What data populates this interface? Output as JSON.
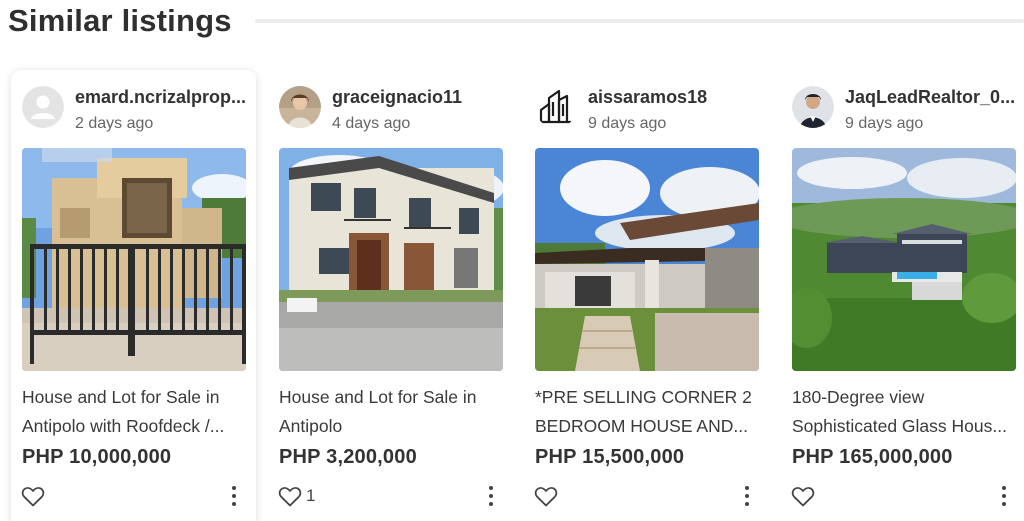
{
  "section": {
    "title": "Similar listings"
  },
  "listings": [
    {
      "user": "emard.ncrizalprop...",
      "time": "2 days ago",
      "title_lines": [
        "House and Lot for Sale in",
        "Antipolo with Roofdeck /..."
      ],
      "price": "PHP 10,000,000",
      "likes": "",
      "avatar_icon": "default-user-icon"
    },
    {
      "user": "graceignacio11",
      "time": "4 days ago",
      "title_lines": [
        "House and Lot for Sale in",
        "Antipolo"
      ],
      "price": "PHP 3,200,000",
      "likes": "1",
      "avatar_icon": "profile-photo"
    },
    {
      "user": "aissaramos18",
      "time": "9 days ago",
      "title_lines": [
        "*PRE SELLING CORNER 2",
        "BEDROOM HOUSE AND..."
      ],
      "price": "PHP 15,500,000",
      "likes": "",
      "avatar_icon": "buildings-logo-icon"
    },
    {
      "user": "JaqLeadRealtor_0...",
      "time": "9 days ago",
      "title_lines": [
        "180-Degree view",
        "Sophisticated Glass Hous..."
      ],
      "price": "PHP 165,000,000",
      "likes": "",
      "avatar_icon": "profile-photo"
    }
  ],
  "colors": {
    "text": "#2b2b2b",
    "muted": "#666666",
    "rule": "#ececec"
  }
}
